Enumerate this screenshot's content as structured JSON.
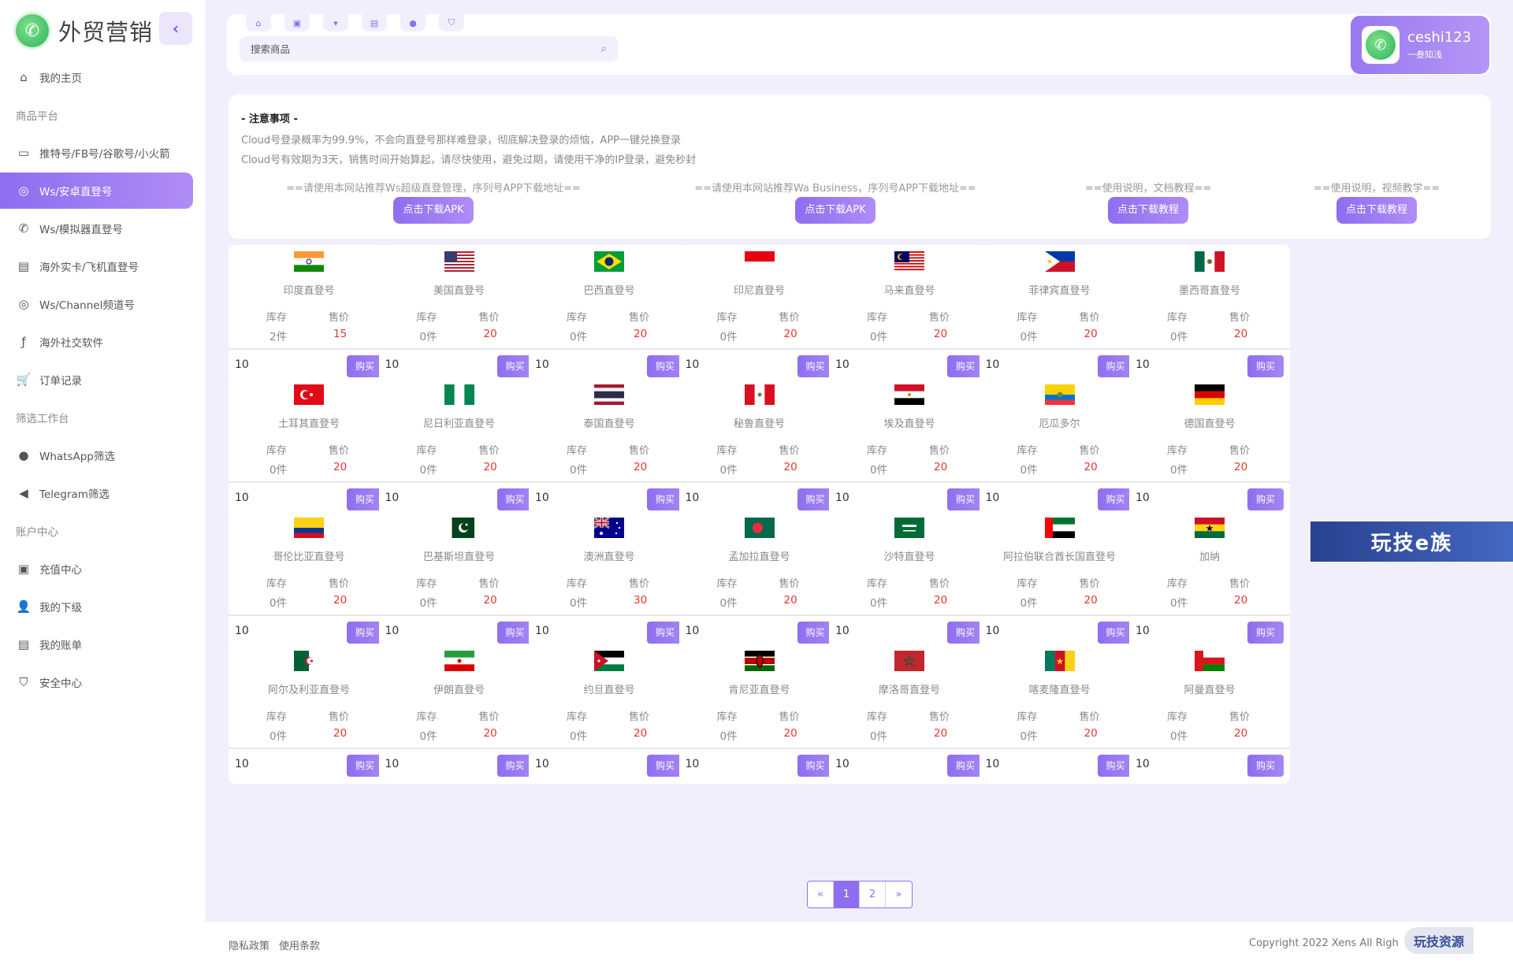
{
  "brand": {
    "name": "外贸营销"
  },
  "nav": [
    {
      "type": "item",
      "label": "我的主页",
      "icon": "home-icon",
      "glyph": "⌂"
    },
    {
      "type": "section",
      "label": "商品平台"
    },
    {
      "type": "item",
      "label": "推特号/FB号/谷歌号/小火箭",
      "icon": "message-icon",
      "glyph": "▭"
    },
    {
      "type": "item",
      "label": "Ws/安卓直登号",
      "icon": "whatsapp-icon",
      "glyph": "◎",
      "active": true
    },
    {
      "type": "item",
      "label": "Ws/模拟器直登号",
      "icon": "phone-icon",
      "glyph": "✆"
    },
    {
      "type": "item",
      "label": "海外实卡/飞机直登号",
      "icon": "document-icon",
      "glyph": "▤"
    },
    {
      "type": "item",
      "label": "Ws/Channel频道号",
      "icon": "whatsapp-icon",
      "glyph": "◎"
    },
    {
      "type": "item",
      "label": "海外社交软件",
      "icon": "facebook-icon",
      "glyph": "ƒ"
    },
    {
      "type": "item",
      "label": "订单记录",
      "icon": "cart-icon",
      "glyph": "🛒"
    },
    {
      "type": "section",
      "label": "筛选工作台"
    },
    {
      "type": "item",
      "label": "WhatsApp筛选",
      "icon": "whatsapp-icon",
      "glyph": "●"
    },
    {
      "type": "item",
      "label": "Telegram筛选",
      "icon": "telegram-icon",
      "glyph": "◀"
    },
    {
      "type": "section",
      "label": "账户中心"
    },
    {
      "type": "item",
      "label": "充值中心",
      "icon": "wallet-icon",
      "glyph": "▣"
    },
    {
      "type": "item",
      "label": "我的下级",
      "icon": "user-icon",
      "glyph": "👤"
    },
    {
      "type": "item",
      "label": "我的账单",
      "icon": "bill-icon",
      "glyph": "▤"
    },
    {
      "type": "item",
      "label": "安全中心",
      "icon": "shield-icon",
      "glyph": "⛉"
    }
  ],
  "toptabs": [
    "home-icon",
    "wallet-icon",
    "cart-icon",
    "bill-icon",
    "user-icon",
    "shield-icon"
  ],
  "search": {
    "placeholder": "搜索商品"
  },
  "user": {
    "name": "ceshi123",
    "subtitle": "一叁知浅"
  },
  "notice": {
    "title": "- 注意事项 -",
    "lines": [
      "Cloud号登录概率为99.9%，不会向直登号那样难登录，彻底解决登录的烦恼，APP一键兑换登录",
      "Cloud号有效期为3天，销售时间开始算起，请尽快使用，避免过期，请使用干净的IP登录，避免秒封"
    ],
    "downloads": [
      {
        "text": "==请使用本网站推荐Ws超级直登管理，序列号APP下载地址==",
        "button": "点击下载APK"
      },
      {
        "text": "==请使用本网站推荐Wa Business，序列号APP下载地址==",
        "button": "点击下载APK"
      },
      {
        "text": "==使用说明，文档教程==",
        "button": "点击下载教程"
      },
      {
        "text": "==使用说明，视频教学==",
        "button": "点击下载教程"
      }
    ]
  },
  "labels": {
    "stock": "库存",
    "price": "售价",
    "buy": "购买"
  },
  "products": [
    {
      "name": "印度直登号",
      "stock": "2件",
      "price": "15",
      "qty": "10",
      "flag": "india"
    },
    {
      "name": "美国直登号",
      "stock": "0件",
      "price": "20",
      "qty": "10",
      "flag": "usa"
    },
    {
      "name": "巴西直登号",
      "stock": "0件",
      "price": "20",
      "qty": "10",
      "flag": "brazil"
    },
    {
      "name": "印尼直登号",
      "stock": "0件",
      "price": "20",
      "qty": "10",
      "flag": "indonesia"
    },
    {
      "name": "马来直登号",
      "stock": "0件",
      "price": "20",
      "qty": "10",
      "flag": "malaysia"
    },
    {
      "name": "菲律宾直登号",
      "stock": "0件",
      "price": "20",
      "qty": "10",
      "flag": "philippines"
    },
    {
      "name": "墨西哥直登号",
      "stock": "0件",
      "price": "20",
      "qty": "10",
      "flag": "mexico"
    },
    {
      "name": "土耳其直登号",
      "stock": "0件",
      "price": "20",
      "qty": "10",
      "flag": "turkey"
    },
    {
      "name": "尼日利亚直登号",
      "stock": "0件",
      "price": "20",
      "qty": "10",
      "flag": "nigeria"
    },
    {
      "name": "泰国直登号",
      "stock": "0件",
      "price": "20",
      "qty": "10",
      "flag": "thailand"
    },
    {
      "name": "秘鲁直登号",
      "stock": "0件",
      "price": "20",
      "qty": "10",
      "flag": "peru"
    },
    {
      "name": "埃及直登号",
      "stock": "0件",
      "price": "20",
      "qty": "10",
      "flag": "egypt"
    },
    {
      "name": "厄瓜多尔",
      "stock": "0件",
      "price": "20",
      "qty": "10",
      "flag": "ecuador"
    },
    {
      "name": "德国直登号",
      "stock": "0件",
      "price": "20",
      "qty": "10",
      "flag": "germany"
    },
    {
      "name": "哥伦比亚直登号",
      "stock": "0件",
      "price": "20",
      "qty": "10",
      "flag": "colombia"
    },
    {
      "name": "巴基斯坦直登号",
      "stock": "0件",
      "price": "20",
      "qty": "10",
      "flag": "pakistan"
    },
    {
      "name": "澳洲直登号",
      "stock": "0件",
      "price": "30",
      "qty": "10",
      "flag": "australia"
    },
    {
      "name": "孟加拉直登号",
      "stock": "0件",
      "price": "20",
      "qty": "10",
      "flag": "bangladesh"
    },
    {
      "name": "沙特直登号",
      "stock": "0件",
      "price": "20",
      "qty": "10",
      "flag": "saudi"
    },
    {
      "name": "阿拉伯联合酋长国直登号",
      "stock": "0件",
      "price": "20",
      "qty": "10",
      "flag": "uae"
    },
    {
      "name": "加纳",
      "stock": "0件",
      "price": "20",
      "qty": "10",
      "flag": "ghana"
    },
    {
      "name": "阿尔及利亚直登号",
      "stock": "0件",
      "price": "20",
      "qty": "10",
      "flag": "algeria"
    },
    {
      "name": "伊朗直登号",
      "stock": "0件",
      "price": "20",
      "qty": "10",
      "flag": "iran"
    },
    {
      "name": "约旦直登号",
      "stock": "0件",
      "price": "20",
      "qty": "10",
      "flag": "jordan"
    },
    {
      "name": "肯尼亚直登号",
      "stock": "0件",
      "price": "20",
      "qty": "10",
      "flag": "kenya"
    },
    {
      "name": "摩洛哥直登号",
      "stock": "0件",
      "price": "20",
      "qty": "10",
      "flag": "morocco"
    },
    {
      "name": "喀麦隆直登号",
      "stock": "0件",
      "price": "20",
      "qty": "10",
      "flag": "cameroon"
    },
    {
      "name": "阿曼直登号",
      "stock": "0件",
      "price": "20",
      "qty": "10",
      "flag": "oman"
    }
  ],
  "pagination": {
    "prev": "«",
    "pages": [
      "1",
      "2"
    ],
    "current": "1",
    "next": "»"
  },
  "footer": {
    "privacy": "隐私政策",
    "terms": "使用条款",
    "copyright": "Copyright 2022 Xens All Righ"
  },
  "watermarks": [
    "玩技e族",
    "玩技资源"
  ],
  "colors": {
    "accent": "#8e6ef0",
    "price": "#e8352d",
    "background": "#f1effb"
  }
}
